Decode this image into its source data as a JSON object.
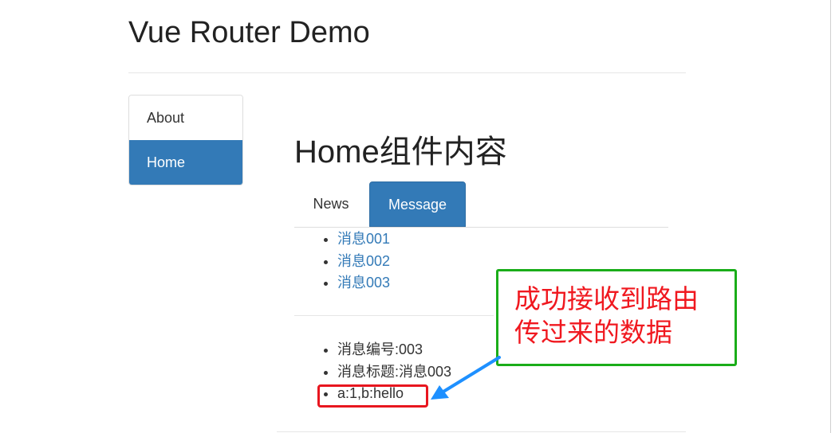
{
  "header": {
    "title": "Vue Router Demo"
  },
  "sidebar": {
    "items": [
      {
        "label": "About",
        "active": false
      },
      {
        "label": "Home",
        "active": true
      }
    ]
  },
  "main": {
    "title": "Home组件内容",
    "tabs": [
      {
        "label": "News",
        "active": false
      },
      {
        "label": "Message",
        "active": true
      }
    ],
    "messages": [
      "消息001",
      "消息002",
      "消息003"
    ],
    "detail": {
      "id_line": "消息编号:003",
      "title_line": "消息标题:消息003",
      "query_line": "a:1,b:hello"
    }
  },
  "annotation": {
    "lines": [
      "成功接收到路由",
      "传过来的数据"
    ],
    "colors": {
      "text": "#f0181f",
      "green_box": "#1aad19",
      "red_box": "#e8161f",
      "arrow": "#1e90ff"
    }
  },
  "colors": {
    "primary": "#337ab7"
  }
}
